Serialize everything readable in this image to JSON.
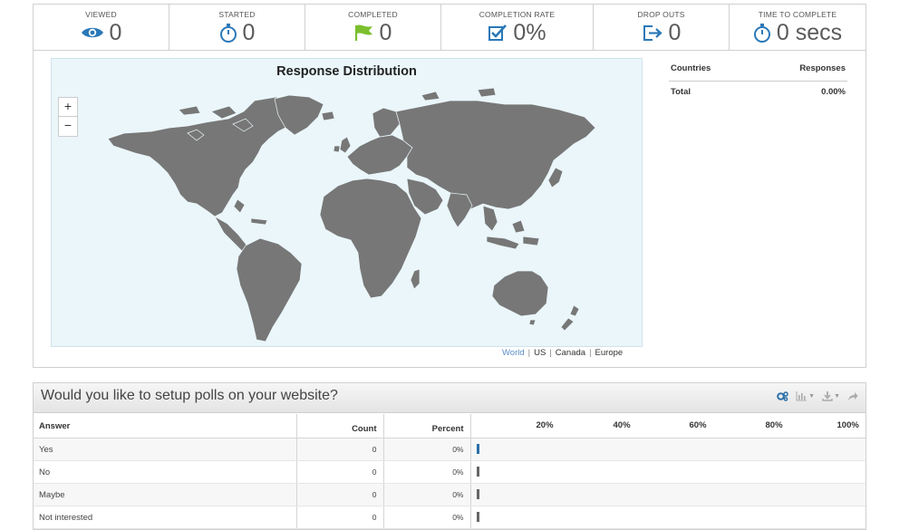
{
  "stats": [
    {
      "label": "VIEWED",
      "value": "0",
      "icon": "eye-icon",
      "color": "#2a78b8"
    },
    {
      "label": "STARTED",
      "value": "0",
      "icon": "stopwatch-icon",
      "color": "#2a78b8"
    },
    {
      "label": "COMPLETED",
      "value": "0",
      "icon": "flag-icon",
      "color": "#7bbf2e"
    },
    {
      "label": "COMPLETION RATE",
      "value": "0%",
      "icon": "checkbox-icon",
      "color": "#2a78b8"
    },
    {
      "label": "DROP OUTS",
      "value": "0",
      "icon": "exit-icon",
      "color": "#2a78b8"
    },
    {
      "label": "TIME TO COMPLETE",
      "value": "0 secs",
      "icon": "timer-icon",
      "color": "#2a78b8"
    }
  ],
  "map": {
    "title": "Response Distribution",
    "zoom_in": "+",
    "zoom_out": "−",
    "region_links": [
      "World",
      "US",
      "Canada",
      "Europe"
    ],
    "active_region": "World",
    "land_color": "#777777",
    "water_color": "#eaf6fa"
  },
  "countries_table": {
    "col_country": "Countries",
    "col_responses": "Responses",
    "total_label": "Total",
    "total_value": "0.00%"
  },
  "poll": {
    "question": "Would you like to setup polls on your website?",
    "columns": {
      "answer": "Answer",
      "count": "Count",
      "percent": "Percent"
    },
    "axis_ticks": [
      "20%",
      "40%",
      "60%",
      "80%",
      "100%"
    ],
    "rows": [
      {
        "answer": "Yes",
        "count": "0",
        "percent": "0%"
      },
      {
        "answer": "No",
        "count": "0",
        "percent": "0%"
      },
      {
        "answer": "Maybe",
        "count": "0",
        "percent": "0%"
      },
      {
        "answer": "Not interested",
        "count": "0",
        "percent": "0%"
      }
    ]
  }
}
